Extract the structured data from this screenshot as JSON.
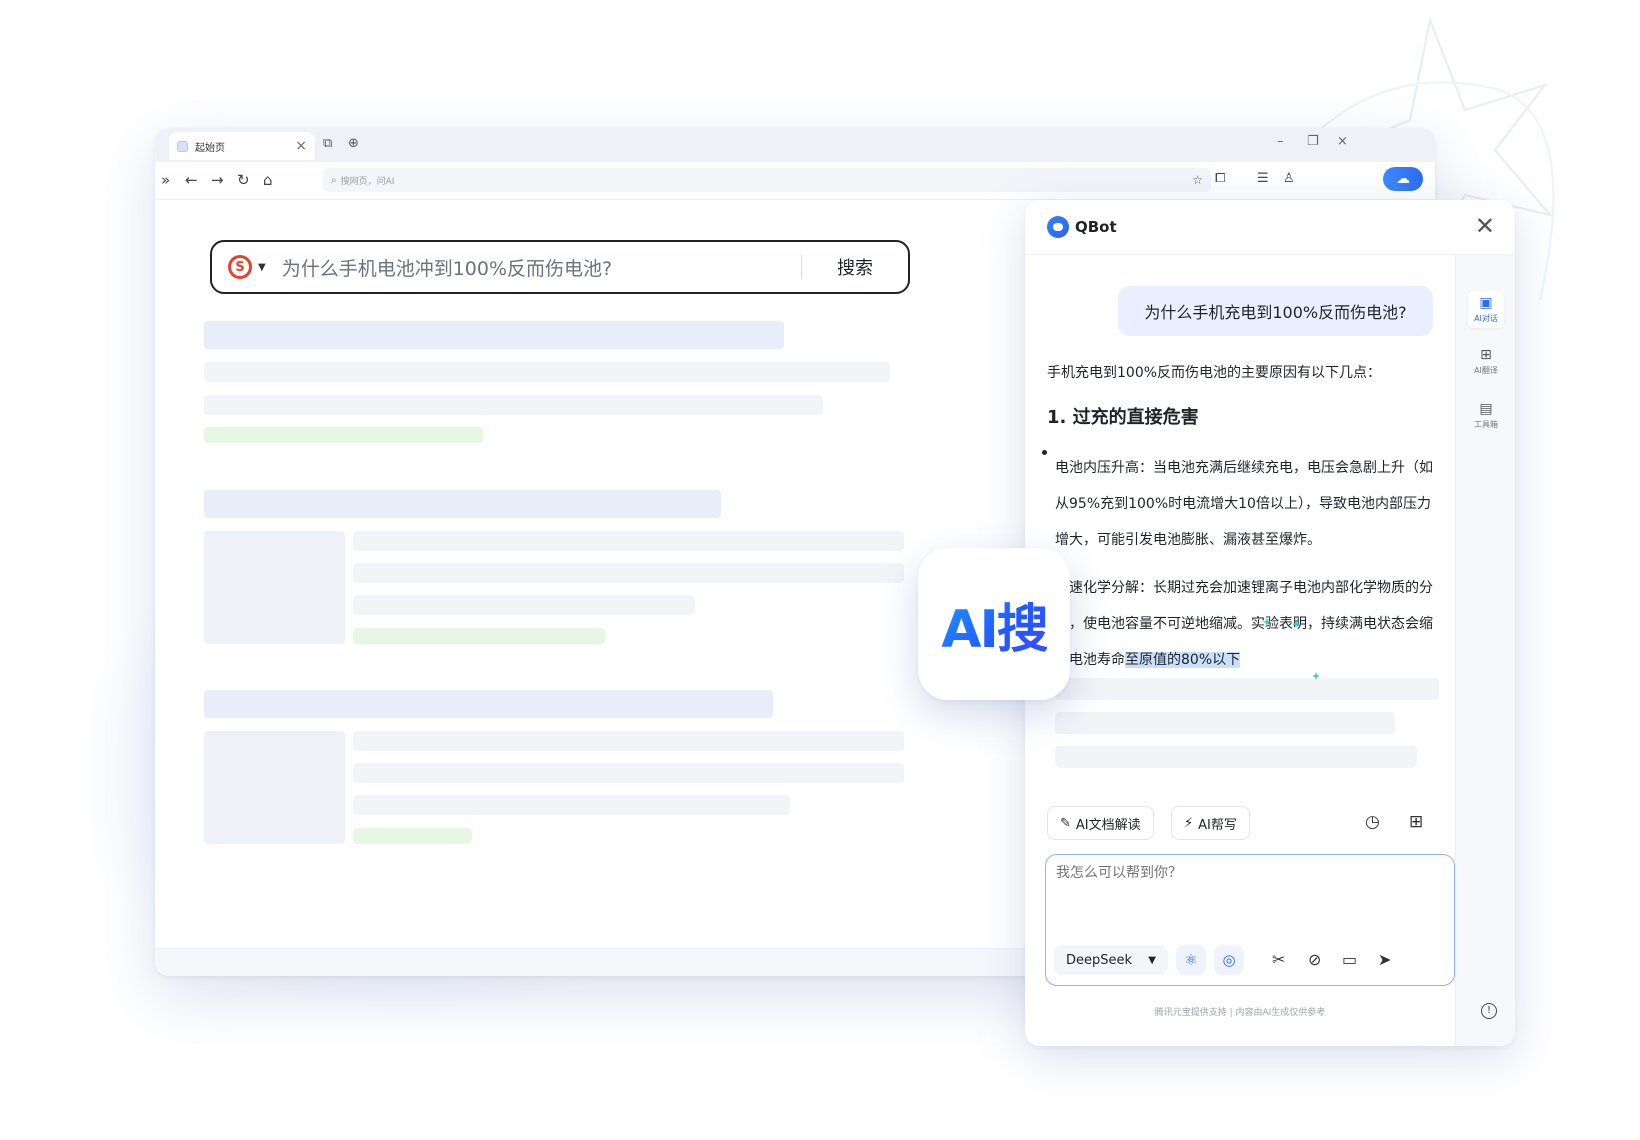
{
  "browser": {
    "tab_title": "起始页",
    "address_placeholder": "搜网页，问AI",
    "colors": {
      "accent": "#2b6cf0",
      "sogou_red": "#e7412a"
    },
    "search": {
      "engine_icon": "sogou-logo-icon",
      "query": "为什么手机电池冲到100%反而伤电池?",
      "button_label": "搜索"
    }
  },
  "badge": {
    "label": "AI搜"
  },
  "qbot": {
    "title": "QBot",
    "rail": [
      {
        "label": "AI对话",
        "icon": "chat-icon"
      },
      {
        "label": "AI翻译",
        "icon": "translate-icon"
      },
      {
        "label": "工具箱",
        "icon": "toolbox-icon"
      }
    ],
    "user_question": "为什么手机充电到100%反而伤电池?",
    "answer": {
      "intro": "手机充电到100%反而伤电池的主要原因有以下几点：",
      "heading": "1. 过充的直接危害",
      "para1": "电池内压升高：当电池充满后继续充电，电压会急剧上升（如从95%充到100%时电流增大10倍以上），导致电池内部压力增大，可能引发电池膨胀、漏液甚至爆炸。",
      "para2_a": "加速化学分解：长期过充会加速锂离子电池内部化学物质的分解，使电池容量不可逆地缩减。实验表明，持续满电状态会缩短电池寿命",
      "para2_highlight": "至原值的80%以下"
    },
    "tools": {
      "doc_read": "AI文档解读",
      "write": "AI帮写"
    },
    "input_placeholder": "我怎么可以帮到你？",
    "model": "DeepSeek",
    "footer": "腾讯元宝提供支持 | 内容由AI生成仅供参考"
  }
}
